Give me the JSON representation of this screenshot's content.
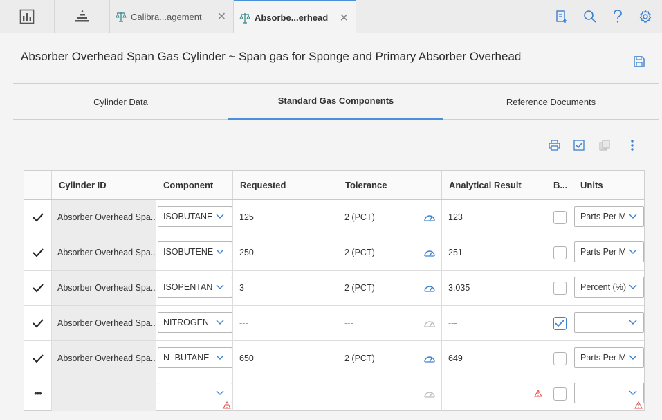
{
  "topbar": {
    "tabs": [
      {
        "label": "Calibra...agement",
        "icon": "scale-icon",
        "close": "✕"
      },
      {
        "label": "Absorbe...erhead",
        "icon": "scale-icon",
        "close": "✕"
      }
    ],
    "left_icons": [
      "dashboard-icon",
      "pyramid-icon"
    ],
    "right_icons": [
      "clipboard-add-icon",
      "search-icon",
      "help-icon",
      "settings-icon"
    ],
    "accent": "#4a90d9"
  },
  "page": {
    "title": "Absorber Overhead Span Gas Cylinder ~ Span gas for Sponge and Primary Absorber Overhead"
  },
  "subtabs": [
    {
      "label": "Cylinder Data",
      "active": false
    },
    {
      "label": "Standard Gas Components",
      "active": true
    },
    {
      "label": "Reference Documents",
      "active": false
    }
  ],
  "toolbar": [
    "print-icon",
    "checklist-icon",
    "copy-icon",
    "more-vertical-icon"
  ],
  "grid": {
    "headers": {
      "cylinder_id": "Cylinder ID",
      "component": "Component",
      "requested": "Requested",
      "tolerance": "Tolerance",
      "analytical": "Analytical Result",
      "b": "B...",
      "units": "Units"
    },
    "rows": [
      {
        "status": "✓",
        "cylinder": "Absorber Overhead Spa...",
        "component": "ISOBUTANE",
        "requested": "125",
        "tolerance": "2 (PCT)",
        "analytical": "123",
        "checked": false,
        "units": "Parts Per M"
      },
      {
        "status": "✓",
        "cylinder": "Absorber Overhead Spa...",
        "component": "ISOBUTENE",
        "requested": "250",
        "tolerance": "2 (PCT)",
        "analytical": "251",
        "checked": false,
        "units": "Parts Per M"
      },
      {
        "status": "✓",
        "cylinder": "Absorber Overhead Spa...",
        "component": "ISOPENTAN",
        "requested": "3",
        "tolerance": "2 (PCT)",
        "analytical": "3.035",
        "checked": false,
        "units": "Percent (%)"
      },
      {
        "status": "✓",
        "cylinder": "Absorber Overhead Spa...",
        "component": "NITROGEN",
        "requested": "---",
        "tolerance": "---",
        "analytical": "---",
        "checked": true,
        "units": ""
      },
      {
        "status": "✓",
        "cylinder": "Absorber Overhead Spa...",
        "component": "N -BUTANE",
        "requested": "650",
        "tolerance": "2 (PCT)",
        "analytical": "649",
        "checked": false,
        "units": "Parts Per M"
      },
      {
        "status": "•••",
        "cylinder": "---",
        "component": "",
        "requested": "---",
        "tolerance": "---",
        "analytical": "---",
        "checked": false,
        "units": ""
      }
    ]
  }
}
